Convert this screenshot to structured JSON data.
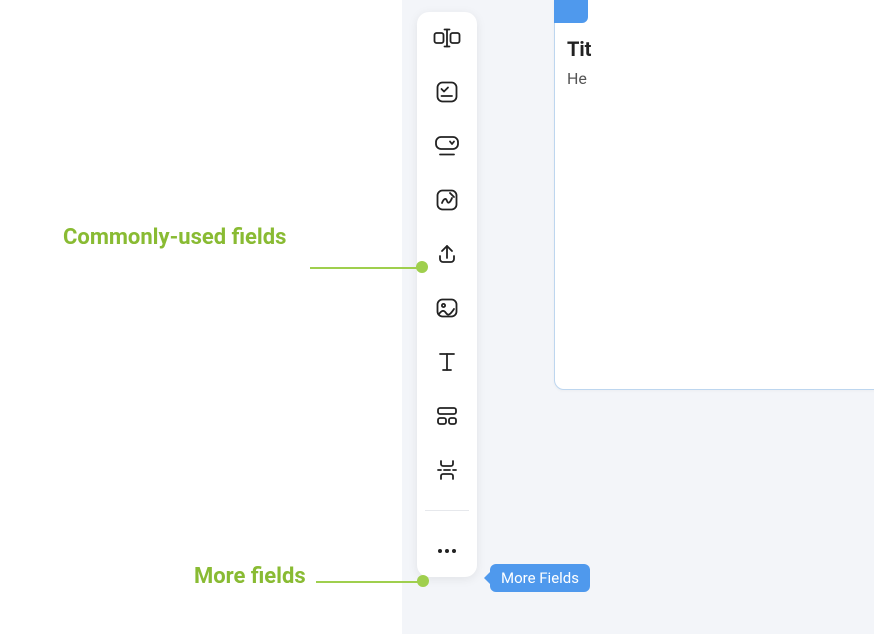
{
  "annotations": {
    "commonly_used": "Commonly-used fields",
    "more_fields": "More fields"
  },
  "tooltip": {
    "more_fields": "More Fields"
  },
  "form_card": {
    "title": "Tit",
    "subtitle": "He"
  },
  "toolbar": {
    "items": [
      {
        "name": "text-input-field-icon"
      },
      {
        "name": "multiple-choice-icon"
      },
      {
        "name": "dropdown-icon"
      },
      {
        "name": "signature-icon"
      },
      {
        "name": "upload-icon"
      },
      {
        "name": "image-icon"
      },
      {
        "name": "heading-icon"
      },
      {
        "name": "section-icon"
      },
      {
        "name": "page-break-icon"
      }
    ],
    "more_label": "…"
  }
}
